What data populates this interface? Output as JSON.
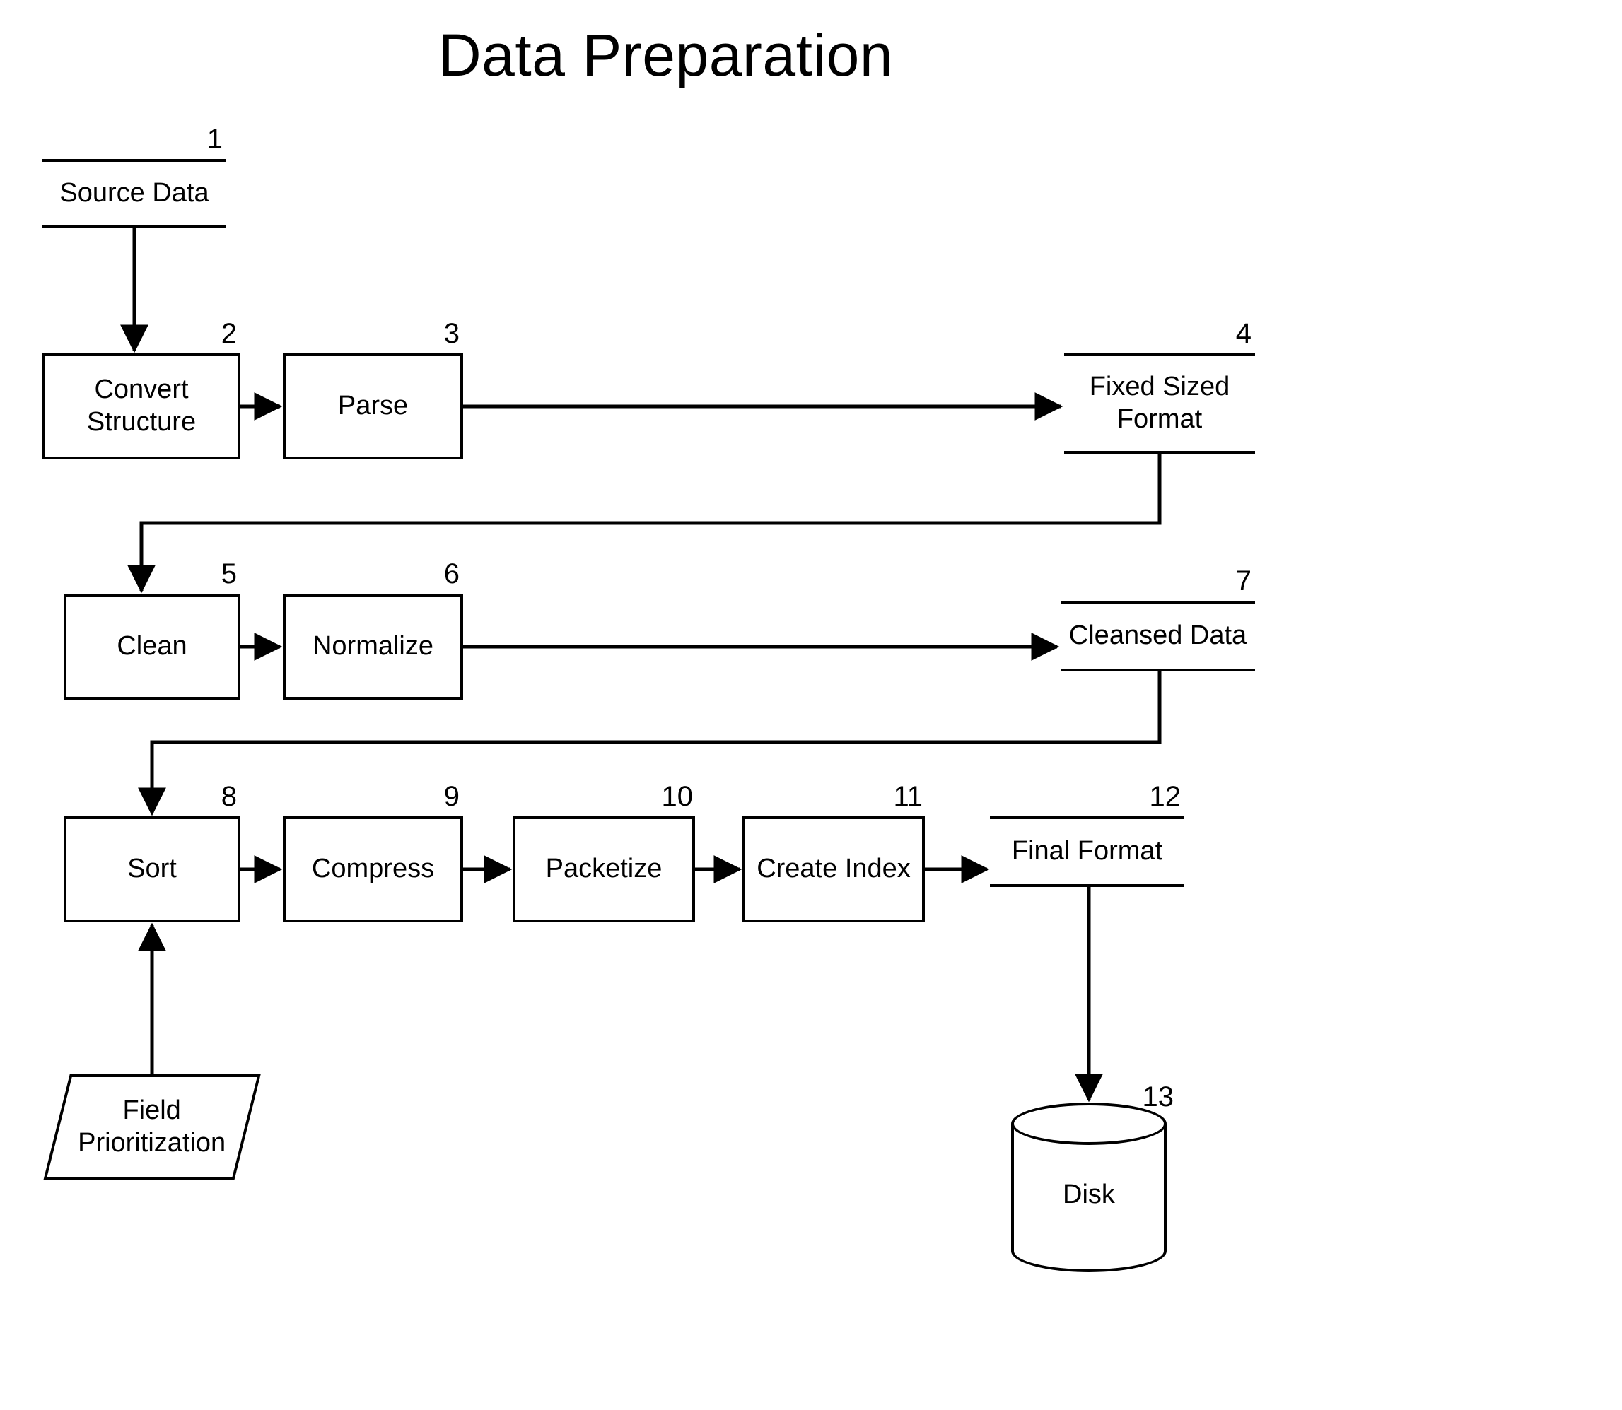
{
  "title": "Data Preparation",
  "nodes": {
    "n1": {
      "num": "1",
      "label": "Source Data"
    },
    "n2": {
      "num": "2",
      "label": "Convert Structure"
    },
    "n3": {
      "num": "3",
      "label": "Parse"
    },
    "n4": {
      "num": "4",
      "label": "Fixed Sized\nFormat"
    },
    "n5": {
      "num": "5",
      "label": "Clean"
    },
    "n6": {
      "num": "6",
      "label": "Normalize"
    },
    "n7": {
      "num": "7",
      "label": "Cleansed Data"
    },
    "n8": {
      "num": "8",
      "label": "Sort"
    },
    "n9": {
      "num": "9",
      "label": "Compress"
    },
    "n10": {
      "num": "10",
      "label": "Packetize"
    },
    "n11": {
      "num": "11",
      "label": "Create Index"
    },
    "n12": {
      "num": "12",
      "label": "Final Format"
    },
    "n13": {
      "num": "13",
      "label": "Disk"
    },
    "fp": {
      "label": "Field\nPrioritization"
    }
  }
}
